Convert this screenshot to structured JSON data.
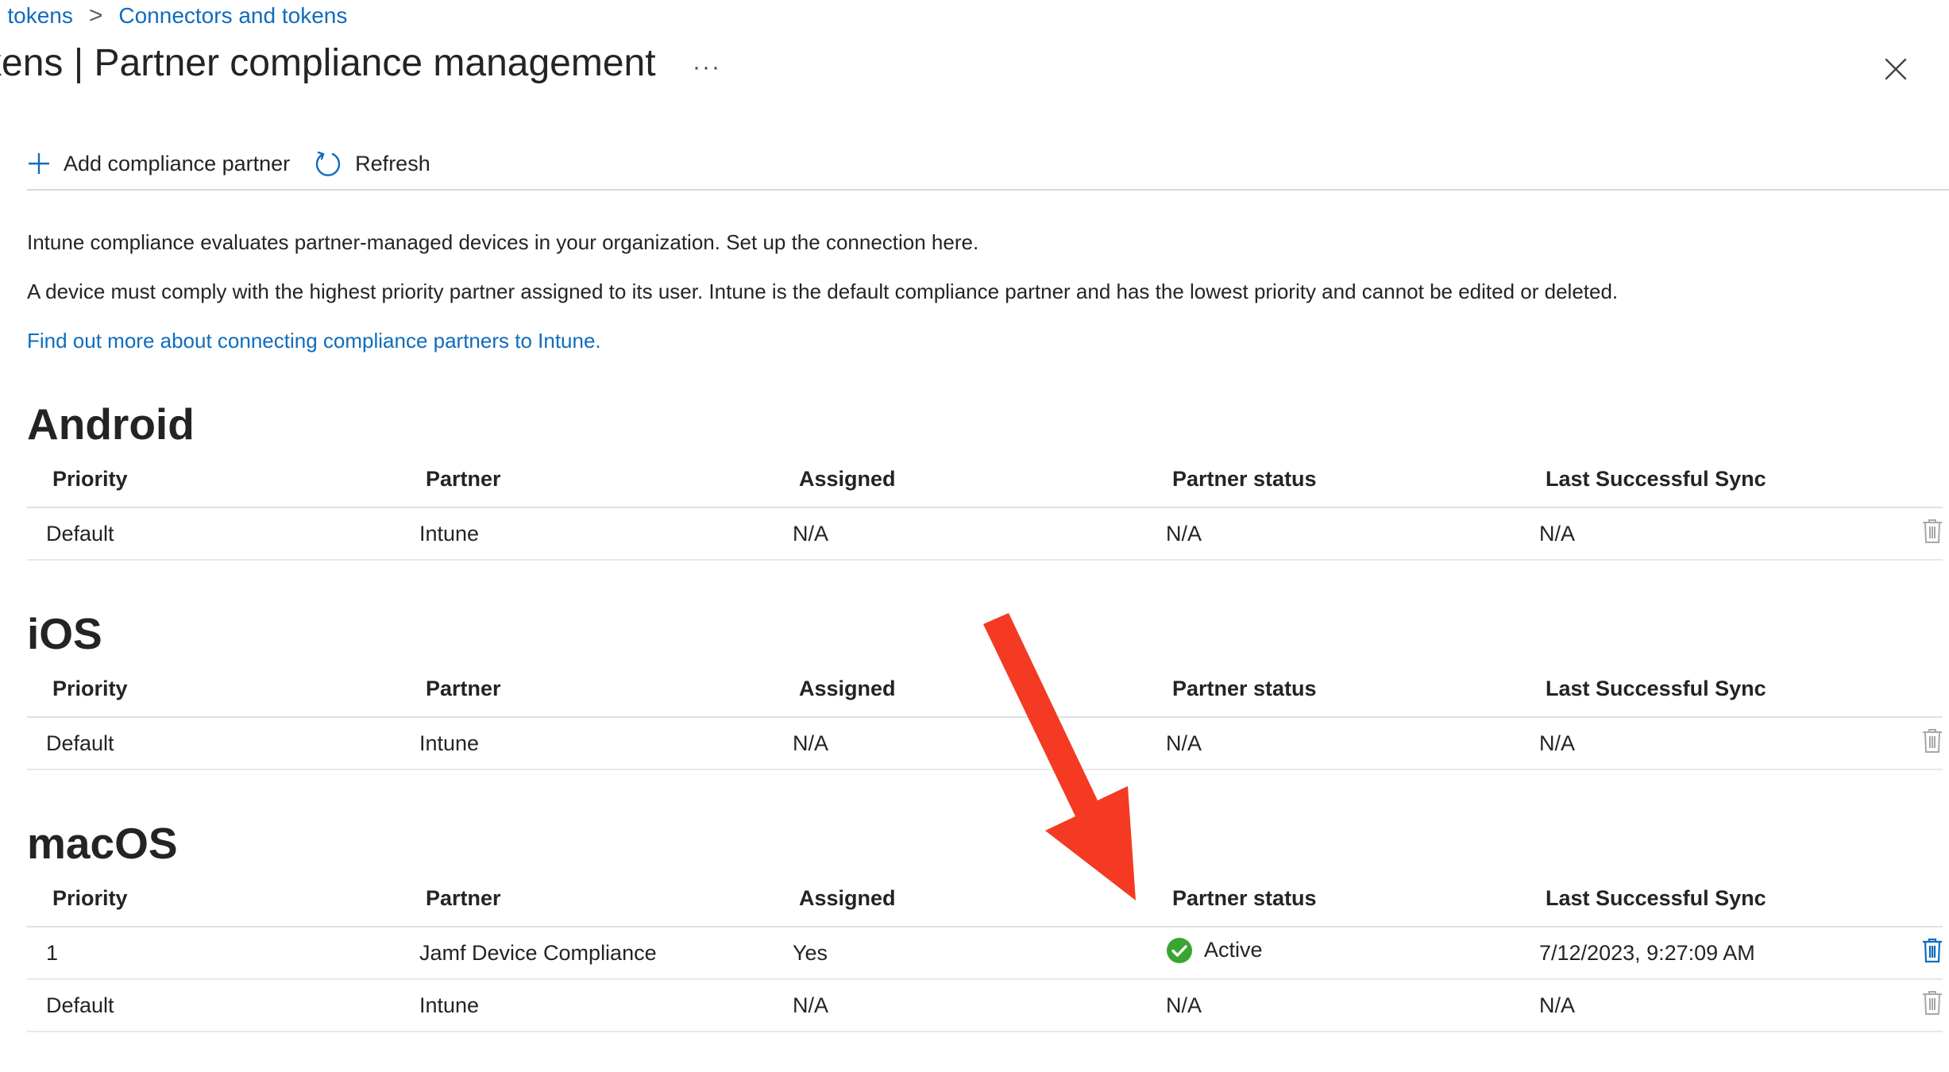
{
  "breadcrumb": {
    "items": [
      "d tokens",
      "Connectors and tokens"
    ],
    "separator": ">"
  },
  "header": {
    "title": "kens | Partner compliance management",
    "more_label": "···"
  },
  "toolbar": {
    "add_label": "Add compliance partner",
    "refresh_label": "Refresh"
  },
  "info": {
    "line1": "Intune compliance evaluates partner-managed devices in your organization. Set up the connection here.",
    "line2": "A device must comply with the highest priority partner assigned to its user. Intune is the default compliance partner and has the lowest priority and cannot be edited or deleted.",
    "link": "Find out more about connecting compliance partners to Intune."
  },
  "columns": [
    "Priority",
    "Partner",
    "Assigned",
    "Partner status",
    "Last Successful Sync"
  ],
  "sections": [
    {
      "title": "Android",
      "rows": [
        {
          "priority": "Default",
          "partner": "Intune",
          "assigned": "N/A",
          "status": "N/A",
          "sync": "N/A"
        }
      ]
    },
    {
      "title": "iOS",
      "rows": [
        {
          "priority": "Default",
          "partner": "Intune",
          "assigned": "N/A",
          "status": "N/A",
          "sync": "N/A"
        }
      ]
    },
    {
      "title": "macOS",
      "rows": [
        {
          "priority": "1",
          "partner": "Jamf Device Compliance",
          "assigned": "Yes",
          "status": "Active",
          "sync": "7/12/2023, 9:27:09 AM"
        },
        {
          "priority": "Default",
          "partner": "Intune",
          "assigned": "N/A",
          "status": "N/A",
          "sync": "N/A"
        }
      ]
    }
  ],
  "icons": {
    "add": "plus-icon",
    "refresh": "refresh-icon",
    "more": "ellipsis-icon",
    "close": "close-icon",
    "delete": "trash-icon",
    "status_active": "check-circle-icon",
    "annotation": "red-arrow"
  },
  "colors": {
    "accent": "#0f6cbd",
    "active_status": "#3aa531",
    "delete_enabled": "#0f6cbd",
    "delete_disabled": "#a8a8a8",
    "annotation_arrow": "#f43a22"
  }
}
